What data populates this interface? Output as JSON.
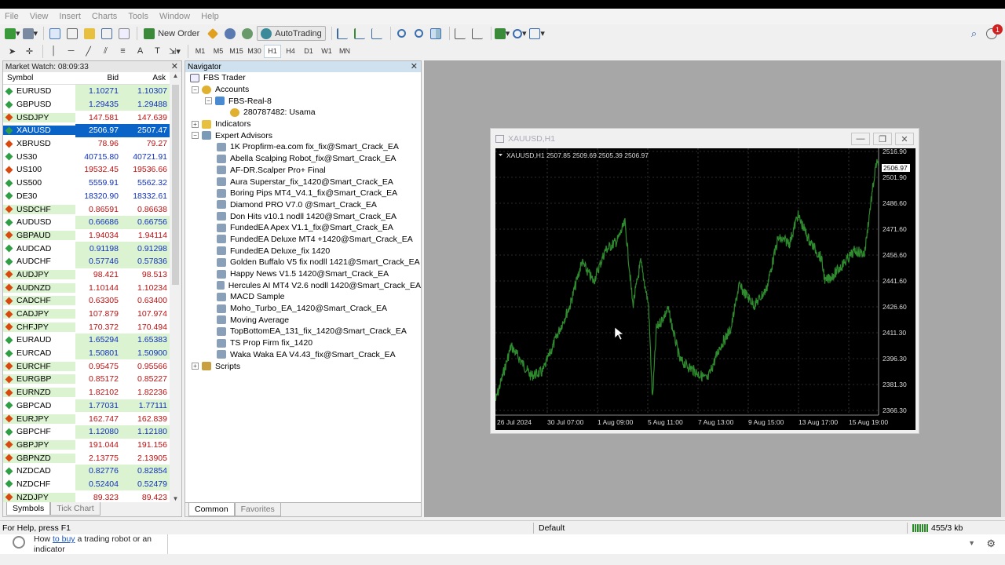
{
  "menu": [
    "File",
    "View",
    "Insert",
    "Charts",
    "Tools",
    "Window",
    "Help"
  ],
  "toolbar": {
    "new_order": "New Order",
    "autotrading": "AutoTrading",
    "timeframes": [
      "M1",
      "M5",
      "M15",
      "M30",
      "H1",
      "H4",
      "D1",
      "W1",
      "MN"
    ],
    "active_timeframe": "H1",
    "notification_count": "1"
  },
  "market_watch": {
    "title": "Market Watch: 08:09:33",
    "columns": [
      "Symbol",
      "Bid",
      "Ask"
    ],
    "rows": [
      {
        "symbol": "EURUSD",
        "bid": "1.10271",
        "ask": "1.10307",
        "dir": "up"
      },
      {
        "symbol": "GBPUSD",
        "bid": "1.29435",
        "ask": "1.29488",
        "dir": "up"
      },
      {
        "symbol": "USDJPY",
        "bid": "147.581",
        "ask": "147.639",
        "dir": "dn",
        "gsym": true
      },
      {
        "symbol": "XAUUSD",
        "bid": "2506.97",
        "ask": "2507.47",
        "dir": "up",
        "selected": true
      },
      {
        "symbol": "XBRUSD",
        "bid": "78.96",
        "ask": "79.27",
        "dir": "dn"
      },
      {
        "symbol": "US30",
        "bid": "40715.80",
        "ask": "40721.91",
        "dir": "up",
        "plain": true
      },
      {
        "symbol": "US100",
        "bid": "19532.45",
        "ask": "19536.66",
        "dir": "dn"
      },
      {
        "symbol": "US500",
        "bid": "5559.91",
        "ask": "5562.32",
        "dir": "up",
        "plain": true
      },
      {
        "symbol": "DE30",
        "bid": "18320.90",
        "ask": "18332.61",
        "dir": "up",
        "plain": true
      },
      {
        "symbol": "USDCHF",
        "bid": "0.86591",
        "ask": "0.86638",
        "dir": "dn",
        "gsym": true
      },
      {
        "symbol": "AUDUSD",
        "bid": "0.66686",
        "ask": "0.66756",
        "dir": "up"
      },
      {
        "symbol": "GBPAUD",
        "bid": "1.94034",
        "ask": "1.94114",
        "dir": "dn",
        "gsym": true
      },
      {
        "symbol": "AUDCAD",
        "bid": "0.91198",
        "ask": "0.91298",
        "dir": "up"
      },
      {
        "symbol": "AUDCHF",
        "bid": "0.57746",
        "ask": "0.57836",
        "dir": "up"
      },
      {
        "symbol": "AUDJPY",
        "bid": "98.421",
        "ask": "98.513",
        "dir": "dn",
        "gsym": true
      },
      {
        "symbol": "AUDNZD",
        "bid": "1.10144",
        "ask": "1.10234",
        "dir": "dn",
        "gsym": true
      },
      {
        "symbol": "CADCHF",
        "bid": "0.63305",
        "ask": "0.63400",
        "dir": "dn",
        "gsym": true
      },
      {
        "symbol": "CADJPY",
        "bid": "107.879",
        "ask": "107.974",
        "dir": "dn",
        "gsym": true
      },
      {
        "symbol": "CHFJPY",
        "bid": "170.372",
        "ask": "170.494",
        "dir": "dn",
        "gsym": true
      },
      {
        "symbol": "EURAUD",
        "bid": "1.65294",
        "ask": "1.65383",
        "dir": "up"
      },
      {
        "symbol": "EURCAD",
        "bid": "1.50801",
        "ask": "1.50900",
        "dir": "up"
      },
      {
        "symbol": "EURCHF",
        "bid": "0.95475",
        "ask": "0.95566",
        "dir": "dn",
        "gsym": true
      },
      {
        "symbol": "EURGBP",
        "bid": "0.85172",
        "ask": "0.85227",
        "dir": "dn",
        "gsym": true
      },
      {
        "symbol": "EURNZD",
        "bid": "1.82102",
        "ask": "1.82236",
        "dir": "dn",
        "gsym": true
      },
      {
        "symbol": "GBPCAD",
        "bid": "1.77031",
        "ask": "1.77111",
        "dir": "up"
      },
      {
        "symbol": "EURJPY",
        "bid": "162.747",
        "ask": "162.839",
        "dir": "dn",
        "gsym": true
      },
      {
        "symbol": "GBPCHF",
        "bid": "1.12080",
        "ask": "1.12180",
        "dir": "up"
      },
      {
        "symbol": "GBPJPY",
        "bid": "191.044",
        "ask": "191.156",
        "dir": "dn",
        "gsym": true
      },
      {
        "symbol": "GBPNZD",
        "bid": "2.13775",
        "ask": "2.13905",
        "dir": "dn",
        "gsym": true
      },
      {
        "symbol": "NZDCAD",
        "bid": "0.82776",
        "ask": "0.82854",
        "dir": "up"
      },
      {
        "symbol": "NZDCHF",
        "bid": "0.52404",
        "ask": "0.52479",
        "dir": "up"
      },
      {
        "symbol": "NZDJPY",
        "bid": "89.323",
        "ask": "89.423",
        "dir": "dn",
        "gsym": true
      }
    ],
    "tabs": [
      "Symbols",
      "Tick Chart"
    ]
  },
  "navigator": {
    "title": "Navigator",
    "root": "FBS Trader",
    "accounts": "Accounts",
    "server": "FBS-Real-8",
    "account": "280787482: Usama",
    "indicators": "Indicators",
    "expert_advisors": "Expert Advisors",
    "experts": [
      "1K  Propfirm-ea.com fix_fix@Smart_Crack_EA",
      "Abella Scalping Robot_fix@Smart_Crack_EA",
      "AF-DR.Scalper Pro+ Final",
      "Aura Superstar_fix_1420@Smart_Crack_EA",
      "Boring Pips MT4_V4.1_fix@Smart_Crack_EA",
      "Diamond PRO V7.0 @Smart_Crack_EA",
      "Don Hits v10.1 nodll 1420@Smart_Crack_EA",
      "FundedEA Apex V1.1_fix@Smart_Crack_EA",
      "FundedEA Deluxe MT4 +1420@Smart_Crack_EA",
      "FundedEA Deluxe_fix 1420",
      "Golden Buffalo V5 fix nodll 1421@Smart_Crack_EA",
      "Happy News V1.5 1420@Smart_Crack_EA",
      "Hercules AI MT4 V2.6 nodll 1420@Smart_Crack_EA",
      "MACD Sample",
      "Moho_Turbo_EA_1420@Smart_Crack_EA",
      "Moving Average",
      "TopBottomEA_131_fix_1420@Smart_Crack_EA",
      "TS Prop Firm fix_1420",
      "Waka Waka EA V4.43_fix@Smart_Crack_EA"
    ],
    "scripts": "Scripts",
    "tabs": [
      "Common",
      "Favorites"
    ]
  },
  "chart_window": {
    "title": "XAUUSD,H1",
    "info": "XAUUSD,H1  2507.85 2509.69 2505.39 2506.97",
    "current_price": "2506.97",
    "price_labels": [
      "2516.90",
      "2501.90",
      "2486.60",
      "2471.60",
      "2456.60",
      "2441.60",
      "2426.60",
      "2411.30",
      "2396.30",
      "2381.30",
      "2366.30"
    ],
    "time_labels": [
      "26 Jul 2024",
      "30 Jul 07:00",
      "1 Aug 09:00",
      "5 Aug 11:00",
      "7 Aug 13:00",
      "9 Aug 15:00",
      "13 Aug 17:00",
      "15 Aug 19:00"
    ],
    "line_color": "#2e8b2e"
  },
  "status": {
    "help": "For Help, press F1",
    "profile": "Default",
    "traffic": "455/3 kb"
  },
  "footer": {
    "msg_pre": "How ",
    "msg_link": "to buy",
    "msg_post": " a trading robot or an indicator"
  }
}
